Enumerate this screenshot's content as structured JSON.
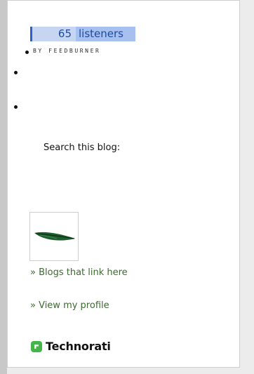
{
  "feedburner": {
    "count": "65",
    "count_label": "listeners",
    "byline": "BY FEEDBURNER"
  },
  "search": {
    "label": "Search this blog:"
  },
  "links": {
    "blogs_link": "» Blogs that link here",
    "profile_link": "» View my profile"
  },
  "technorati": {
    "logo_text": "Technorati",
    "logo_color": "#44b649"
  },
  "icons": {
    "thumbnail": "feather-icon",
    "technorati_logo": "technorati-logo-icon"
  },
  "colors": {
    "link": "#3c6a2f",
    "chicklet_blue": "#a6c0ef"
  }
}
